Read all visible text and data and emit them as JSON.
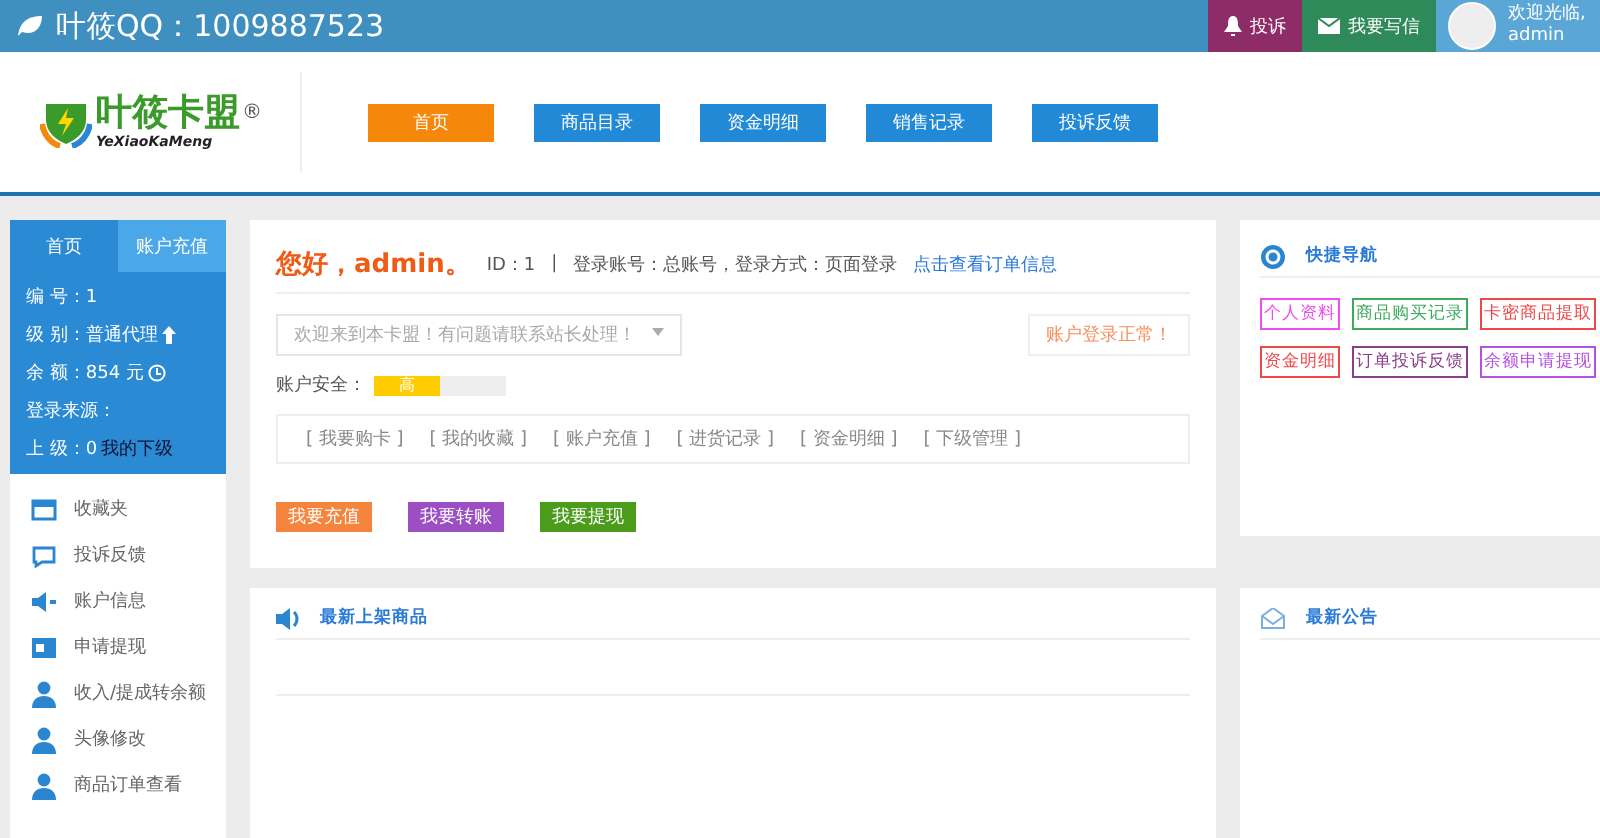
{
  "top_bar": {
    "title": "叶筱QQ：1009887523",
    "buttons": [
      {
        "kind": "complaint",
        "label": "投诉"
      },
      {
        "kind": "mail",
        "label": "我要写信"
      }
    ],
    "welcome": "欢迎光临,",
    "user": "admin"
  },
  "header": {
    "logo_text": "叶筱卡盟",
    "logo_mark": "®",
    "logo_subtext": "YeXiaoKaMeng",
    "nav": [
      {
        "label": "首页",
        "selected": true
      },
      {
        "label": "商品目录",
        "selected": false
      },
      {
        "label": "资金明细",
        "selected": false
      },
      {
        "label": "销售记录",
        "selected": false
      },
      {
        "label": "投诉反馈",
        "selected": false
      }
    ]
  },
  "sidebar": {
    "tabs": [
      {
        "label": "首页",
        "selected": true
      },
      {
        "label": "账户充值",
        "selected": false
      }
    ],
    "info": [
      {
        "text": "编 号：1"
      },
      {
        "text": "级 别：普通代理",
        "kind": "level"
      },
      {
        "text": "余 额：854 元",
        "kind": "balance"
      },
      {
        "text": "登录来源："
      },
      {
        "text": "上 级：0",
        "link": "我的下级"
      }
    ],
    "items": [
      {
        "kind": "folder",
        "label": "收藏夹"
      },
      {
        "kind": "chat",
        "label": "投诉反馈"
      },
      {
        "kind": "speaker",
        "label": "账户信息"
      },
      {
        "kind": "card",
        "label": "申请提现"
      },
      {
        "kind": "user",
        "label": "收入/提成转余额"
      },
      {
        "kind": "user",
        "label": "头像修改"
      },
      {
        "kind": "user",
        "label": "商品订单查看"
      }
    ]
  },
  "account": {
    "greeting": "您好，admin。",
    "id": "ID：1",
    "separator": "|",
    "login_info": "登录账号：总账号，登录方式：页面登录",
    "order_link": "点击查看订单信息",
    "notice": "欢迎来到本卡盟！有问题请联系站长处理！",
    "status": "账户登录正常！",
    "security_label": "账户安全：",
    "security": {
      "text": "高",
      "level": 0.5
    },
    "links": [
      "[ 我要购卡 ]",
      "[ 我的收藏 ]",
      "[ 账户充值 ]",
      "[ 进货记录 ]",
      "[ 资金明细 ]",
      "[ 下级管理 ]"
    ],
    "actions": [
      {
        "label": "我要充值",
        "color": "#f5843c"
      },
      {
        "label": "我要转账",
        "color": "#9b4fc2"
      },
      {
        "label": "我要提现",
        "color": "#4a9c1a"
      }
    ]
  },
  "quick_nav": {
    "title": "快捷导航",
    "items": [
      {
        "label": "个人资料",
        "color": "#f04cf0"
      },
      {
        "label": "商品购买记录",
        "color": "#3daa5c"
      },
      {
        "label": "卡密商品提取",
        "color": "#f04848"
      },
      {
        "label": "资金明细",
        "color": "#f04848"
      },
      {
        "label": "订单投诉反馈",
        "color": "#8a3d8a"
      },
      {
        "label": "余额申请提现",
        "color": "#b451e0"
      }
    ]
  },
  "new_products": {
    "title": "最新上架商品"
  },
  "announcements": {
    "title": "最新公告"
  }
}
